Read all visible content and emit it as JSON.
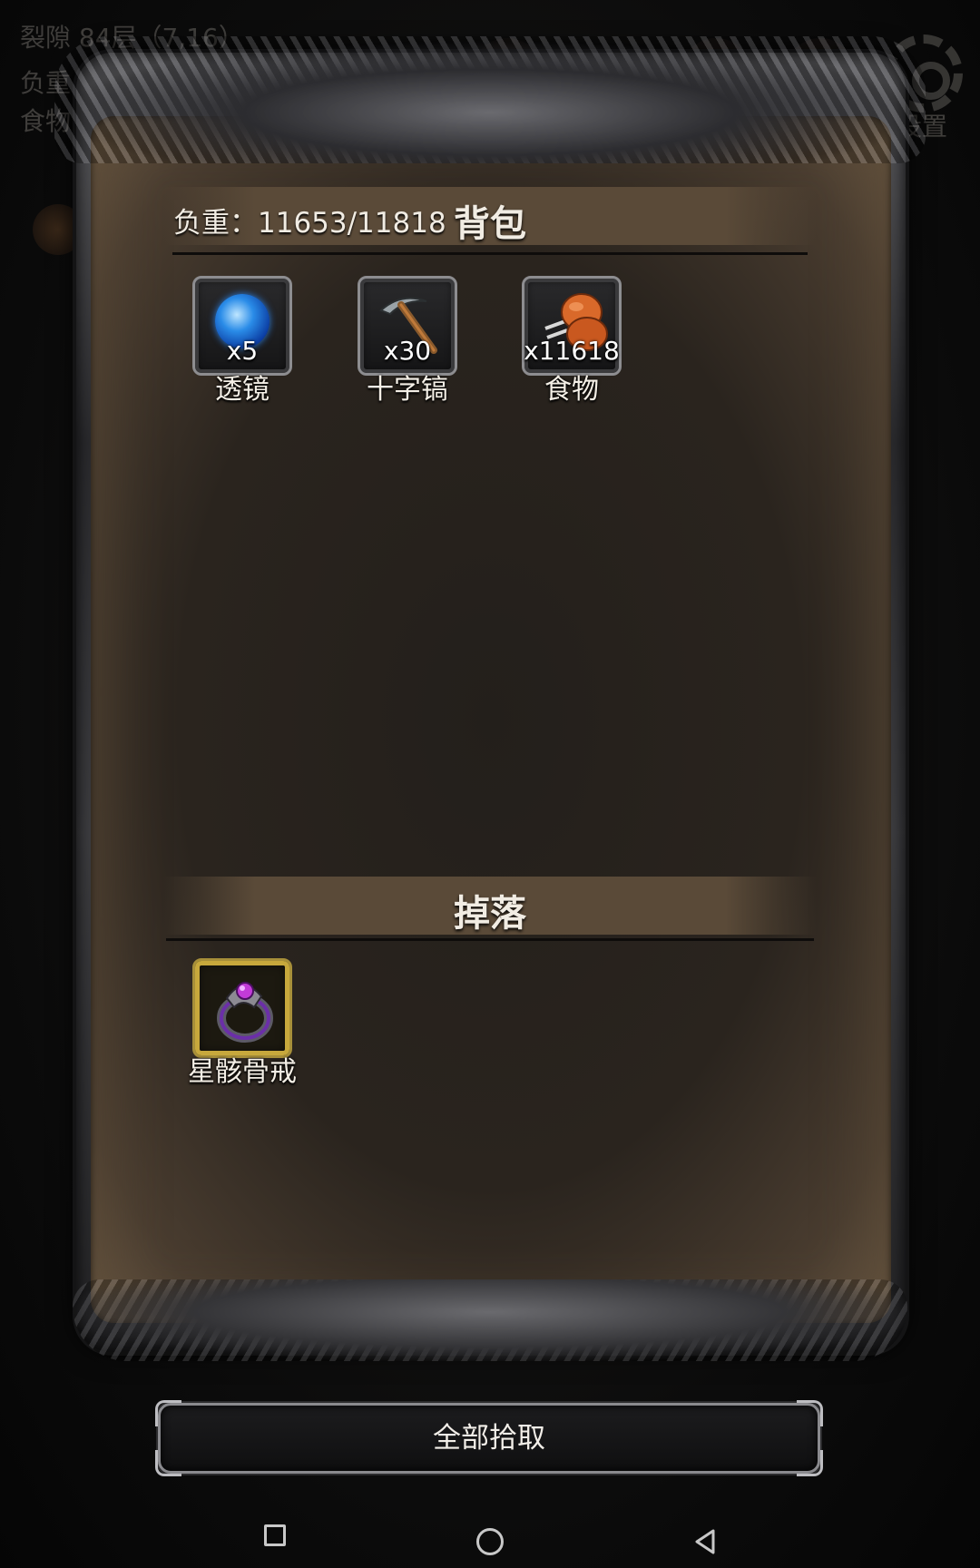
{
  "background_hud": {
    "floor": "裂隙 84层（7,16）",
    "load": "负重：11653/",
    "food": "食物",
    "settings_label": "设置"
  },
  "bag": {
    "load_label": "负重：11653/11818",
    "title": "背包",
    "items": [
      {
        "icon": "lens-icon",
        "count": "x5",
        "name": "透镜"
      },
      {
        "icon": "pickaxe-icon",
        "count": "x30",
        "name": "十字镐"
      },
      {
        "icon": "food-icon",
        "count": "x11618",
        "name": "食物"
      }
    ]
  },
  "drop": {
    "title": "掉落",
    "items": [
      {
        "icon": "ring-icon",
        "name": "星骸骨戒",
        "rarity_color": "#c7a83c"
      }
    ]
  },
  "actions": {
    "pickup_all": "全部拾取"
  },
  "nav": {
    "recent": "recent-apps-icon",
    "home": "home-icon",
    "back": "back-icon"
  }
}
